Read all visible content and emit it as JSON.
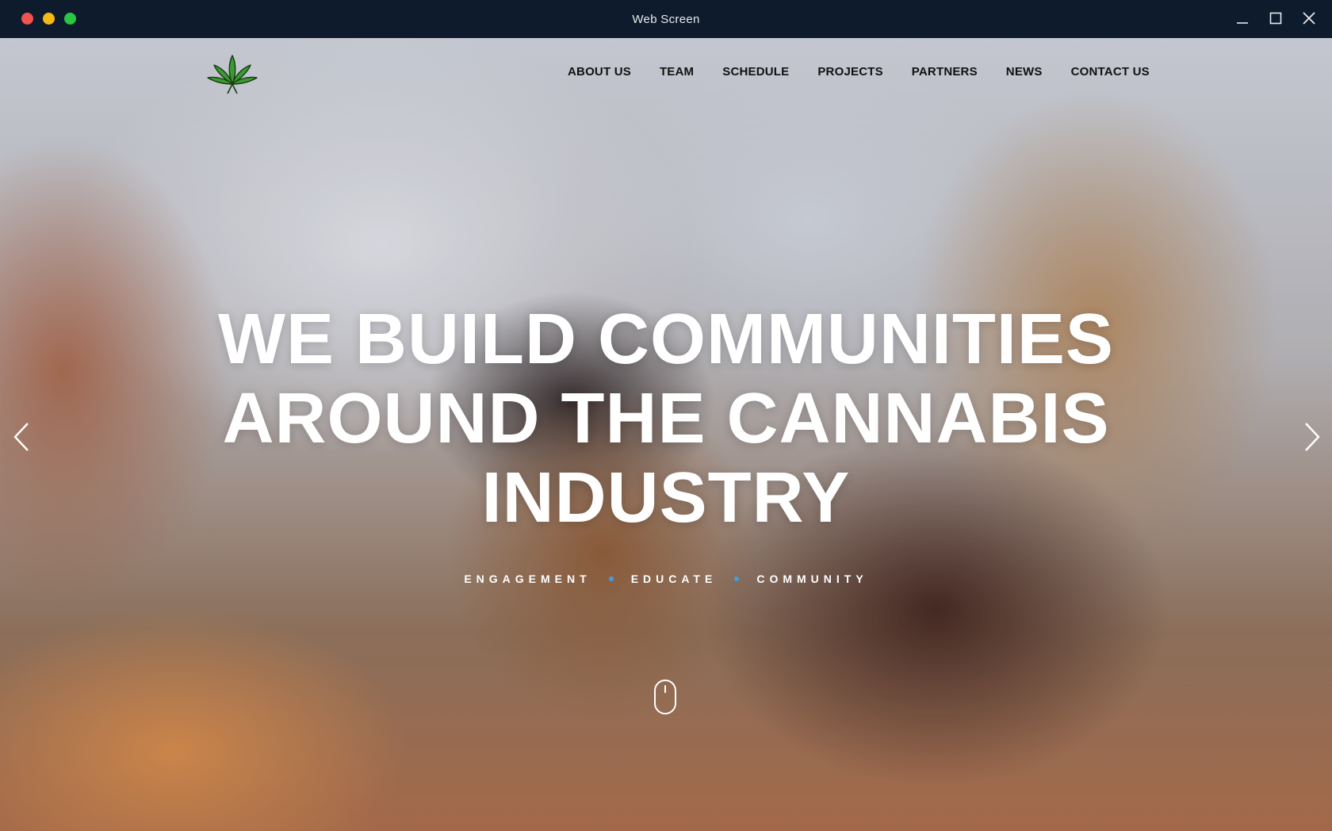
{
  "window": {
    "title": "Web Screen"
  },
  "header": {
    "logo_icon": "cannabis-leaf-icon",
    "nav": [
      {
        "label": "ABOUT US"
      },
      {
        "label": "TEAM"
      },
      {
        "label": "SCHEDULE"
      },
      {
        "label": "PROJECTS"
      },
      {
        "label": "PARTNERS"
      },
      {
        "label": "NEWS"
      },
      {
        "label": "CONTACT US"
      }
    ]
  },
  "hero": {
    "headline_lines": [
      "WE BUILD COMMUNITIES",
      "AROUND THE CANNABIS",
      "INDUSTRY"
    ],
    "tagline": [
      "ENGAGEMENT",
      "EDUCATE",
      "COMMUNITY"
    ],
    "tagline_separator_color": "#3fa0e0",
    "prev_icon": "chevron-left-icon",
    "next_icon": "chevron-right-icon",
    "scroll_icon": "mouse-scroll-icon"
  },
  "colors": {
    "titlebar": "#0d1b2c",
    "logo_green": "#3b9a32",
    "nav_text": "#111111",
    "headline": "#ffffff"
  }
}
